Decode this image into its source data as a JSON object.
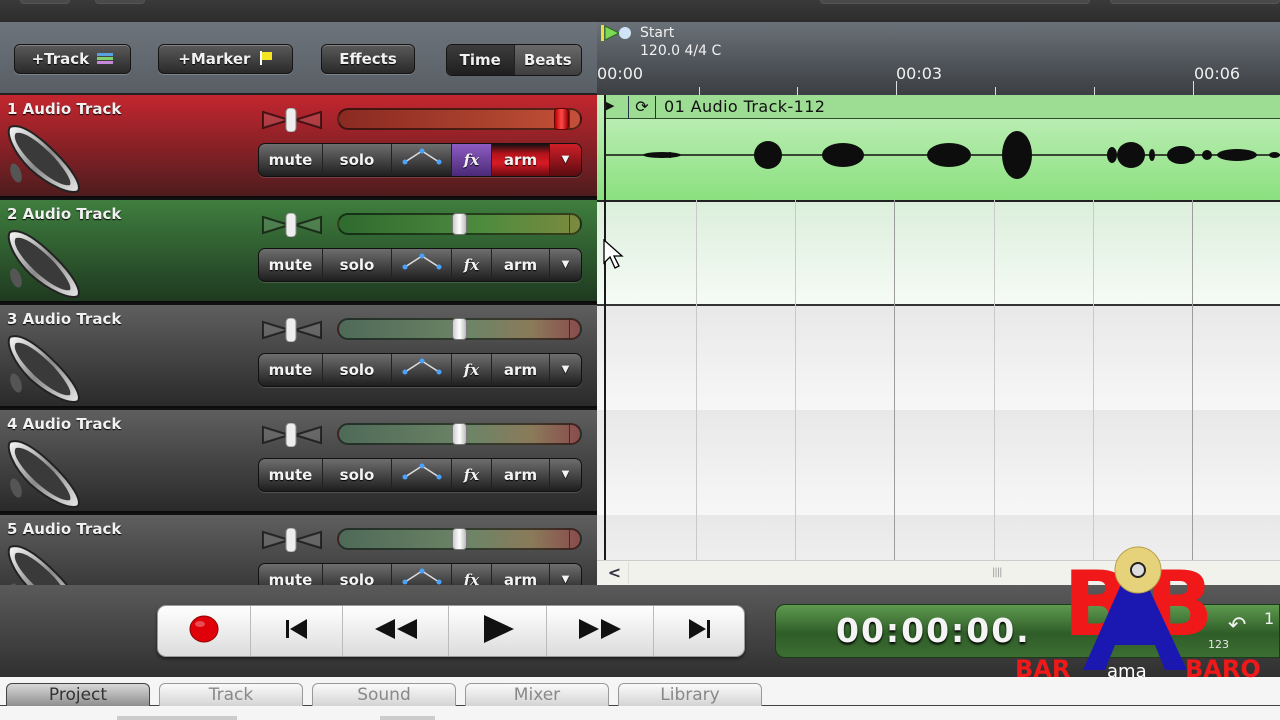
{
  "toolbar": {
    "add_track_label": "+Track",
    "add_marker_label": "+Marker",
    "effects_label": "Effects",
    "view_modes": [
      {
        "label": "Time",
        "active": true
      },
      {
        "label": "Beats",
        "active": false
      }
    ]
  },
  "ruler": {
    "start_marker": "Start",
    "tempo_signature": "120.0 4/4 C",
    "ticks": [
      "00:00",
      "00:03",
      "00:06"
    ]
  },
  "tracks": [
    {
      "name": "1 Audio Track",
      "theme": "red",
      "color": "#c4262f",
      "volume_level": 0.95,
      "pan": 0.0,
      "mute": "mute",
      "solo": "solo",
      "fx": "fx",
      "arm": "arm",
      "fx_active": true,
      "armed": true
    },
    {
      "name": "2 Audio Track",
      "theme": "green",
      "color": "#3f7e3e",
      "volume_level": 0.5,
      "pan": 0.0,
      "mute": "mute",
      "solo": "solo",
      "fx": "fx",
      "arm": "arm",
      "fx_active": false,
      "armed": false
    },
    {
      "name": "3 Audio Track",
      "theme": "gray",
      "color": "#5f5f5f",
      "volume_level": 0.5,
      "pan": 0.0,
      "mute": "mute",
      "solo": "solo",
      "fx": "fx",
      "arm": "arm",
      "fx_active": false,
      "armed": false
    },
    {
      "name": "4 Audio Track",
      "theme": "gray",
      "color": "#5f5f5f",
      "volume_level": 0.5,
      "pan": 0.0,
      "mute": "mute",
      "solo": "solo",
      "fx": "fx",
      "arm": "arm",
      "fx_active": false,
      "armed": false
    },
    {
      "name": "5 Audio Track",
      "theme": "gray",
      "color": "#5f5f5f",
      "volume_level": 0.5,
      "pan": 0.0,
      "mute": "mute",
      "solo": "solo",
      "fx": "fx",
      "arm": "arm",
      "fx_active": false,
      "armed": false
    }
  ],
  "clip": {
    "name": "01 Audio Track-112",
    "color": "#9ddd93"
  },
  "transport": {
    "buttons": [
      "record",
      "go-to-start",
      "rewind",
      "play",
      "fast-forward",
      "go-to-end"
    ],
    "time_display": "00:00:00.",
    "sub_label": "123",
    "record_color": "#e0000a"
  },
  "tabs": [
    {
      "label": "Project",
      "active": true
    },
    {
      "label": "Track",
      "active": false
    },
    {
      "label": "Sound",
      "active": false
    },
    {
      "label": "Mixer",
      "active": false
    },
    {
      "label": "Library",
      "active": false
    }
  ],
  "watermark": {
    "line1": "BAR",
    "line2": "ama",
    "line3": "BARO"
  }
}
